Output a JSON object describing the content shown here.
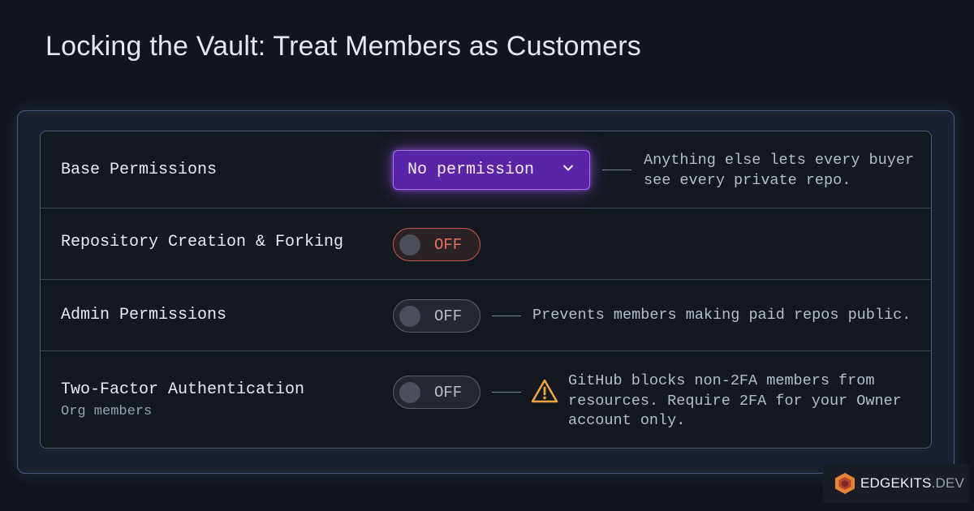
{
  "page": {
    "title": "Locking the Vault: Treat Members as Customers"
  },
  "settings": {
    "base_permissions": {
      "label": "Base Permissions",
      "select_value": "No permission",
      "note_line1": "Anything else lets every buyer",
      "note_line2": "see every private repo."
    },
    "repo_creation": {
      "label": "Repository Creation & Forking",
      "toggle_state": "OFF"
    },
    "admin_permissions": {
      "label": "Admin Permissions",
      "toggle_state": "OFF",
      "note": "Prevents members making paid repos public."
    },
    "two_factor": {
      "label": "Two-Factor Authentication",
      "sublabel": "Org members",
      "toggle_state": "OFF",
      "note_line1": "GitHub blocks non-2FA members from",
      "note_line2": "resources. Require 2FA for your Owner",
      "note_line3": "account only."
    }
  },
  "branding": {
    "name": "EDGEKITS",
    "tld": ".DEV"
  },
  "colors": {
    "accent_purple": "#5a24a8",
    "toggle_off_red": "#e4715f",
    "warning_amber": "#f0a640",
    "background": "#11151c"
  },
  "icons": {
    "select_chevron": "chevron-down-icon",
    "warning": "warning-triangle-icon",
    "logo": "hexagon-logo-icon"
  }
}
